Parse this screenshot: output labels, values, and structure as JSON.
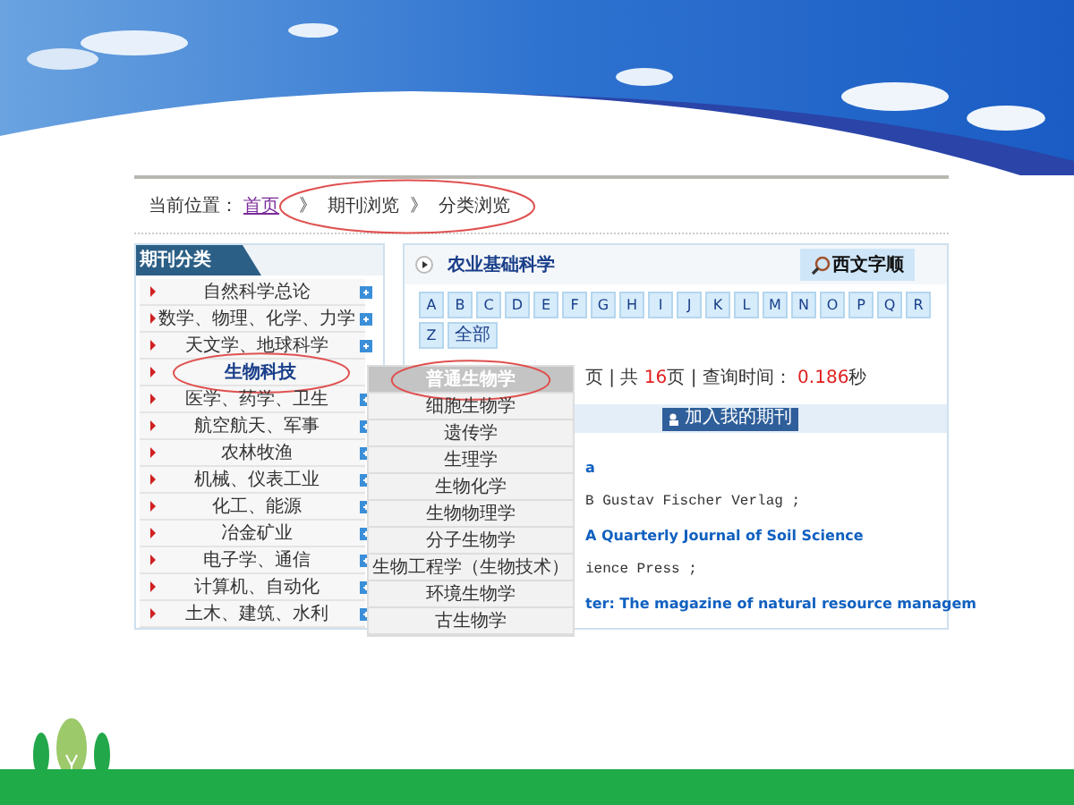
{
  "breadcrumb": {
    "label": "当前位置：",
    "items": [
      {
        "text": "首页",
        "kind": "link"
      },
      {
        "text": "》",
        "kind": "separator"
      },
      {
        "text": "期刊浏览",
        "kind": "plain"
      },
      {
        "text": "》",
        "kind": "separator"
      },
      {
        "text": "分类浏览",
        "kind": "plain"
      }
    ]
  },
  "sidebar": {
    "title": "期刊分类",
    "items": [
      {
        "label": "自然科学总论",
        "selected": false
      },
      {
        "label": "数学、物理、化学、力学",
        "selected": false
      },
      {
        "label": "天文学、地球科学",
        "selected": false
      },
      {
        "label": "生物科技",
        "selected": true
      },
      {
        "label": "医学、药学、卫生",
        "selected": false
      },
      {
        "label": "航空航天、军事",
        "selected": false
      },
      {
        "label": "农林牧渔",
        "selected": false
      },
      {
        "label": "机械、仪表工业",
        "selected": false
      },
      {
        "label": "化工、能源",
        "selected": false
      },
      {
        "label": "冶金矿业",
        "selected": false
      },
      {
        "label": "电子学、通信",
        "selected": false
      },
      {
        "label": "计算机、自动化",
        "selected": false
      },
      {
        "label": "土木、建筑、水利",
        "selected": false
      }
    ]
  },
  "submenu": {
    "items": [
      {
        "label": "普通生物学",
        "selected": true
      },
      {
        "label": "细胞生物学",
        "selected": false
      },
      {
        "label": "遗传学",
        "selected": false
      },
      {
        "label": "生理学",
        "selected": false
      },
      {
        "label": "生物化学",
        "selected": false
      },
      {
        "label": "生物物理学",
        "selected": false
      },
      {
        "label": "分子生物学",
        "selected": false
      },
      {
        "label": "生物工程学（生物技术）",
        "selected": false
      },
      {
        "label": "环境生物学",
        "selected": false
      },
      {
        "label": "古生物学",
        "selected": false
      }
    ]
  },
  "panel": {
    "title": "农业基础科学",
    "tab": "西文字顺",
    "letters": [
      "A",
      "B",
      "C",
      "D",
      "E",
      "F",
      "G",
      "H",
      "I",
      "J",
      "K",
      "L",
      "M",
      "N",
      "O",
      "P",
      "Q",
      "R",
      "Z",
      "全部"
    ],
    "pagination": [
      {
        "text": "页 | 共 ",
        "highlight": false
      },
      {
        "text": "16",
        "highlight": true
      },
      {
        "text": "页 |  查询时间： ",
        "highlight": false
      },
      {
        "text": "0.186",
        "highlight": true
      },
      {
        "text": "秒",
        "highlight": false
      }
    ],
    "add_button": "加入我的期刊",
    "results": [
      {
        "text": "a",
        "kind": "link"
      },
      {
        "text": "B Gustav Fischer Verlag ;",
        "kind": "publisher"
      },
      {
        "text": "A Quarterly Journal of Soil Science",
        "kind": "link"
      },
      {
        "text": "ience Press ;",
        "kind": "publisher"
      },
      {
        "text": "ter: The magazine of natural resource managem",
        "kind": "link"
      }
    ]
  }
}
